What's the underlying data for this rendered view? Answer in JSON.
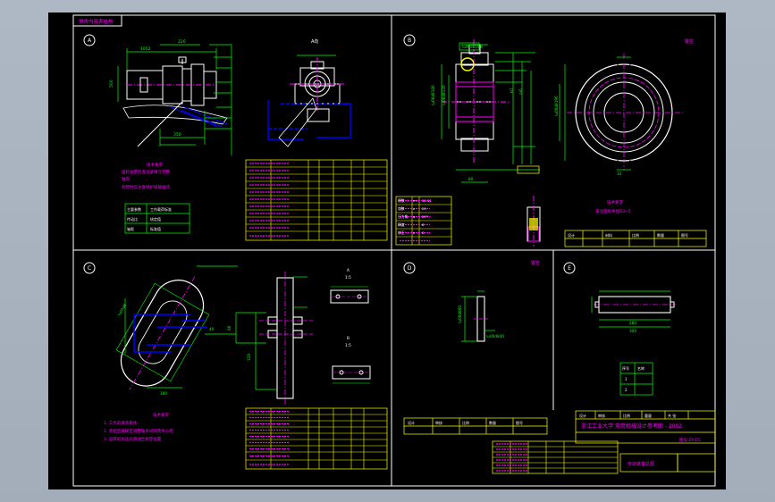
{
  "viewport": {
    "background": "#a9b3c0",
    "canvas_background": "#000000"
  },
  "colors": {
    "frame": "#ffffff",
    "tables": "#ffff00",
    "drawing": "#ffffff",
    "dimensions": "#00ff00",
    "hidden": "#0000ff",
    "centerlines": "#ff00ff",
    "notes": "#ff00ff",
    "highlight": "#ffff00"
  },
  "title_tag": "常青内容表结构",
  "panels": [
    {
      "id": "A",
      "label": "A"
    },
    {
      "id": "B",
      "label": "B"
    },
    {
      "id": "C",
      "label": "C"
    },
    {
      "id": "D",
      "label": "D"
    },
    {
      "id": "E",
      "label": "E"
    }
  ],
  "panel_texts": {
    "a_view": "A向",
    "b_note": "譬空",
    "d_note": "譬空"
  },
  "notes": {
    "a_tech_title": "技术要求",
    "a_tech_lines": [
      "齿轮质量检查记录填写完整",
      "轴向",
      "装配时应注意保护纵轴轴流"
    ],
    "a_small_table": [
      [
        "主要参数",
        "工作载荷标准"
      ],
      [
        "传动比",
        "核定值"
      ],
      [
        "轴距",
        "标准值"
      ]
    ],
    "b_tech_title": "技术要求",
    "b_tech_line": "未注圆角半径R3~5",
    "c_tech_title": "技术要求",
    "c_tech_lines": [
      "1. 工作前清洗箱体",
      "2. 装配后按规定调整轴承间隙及中心距",
      "3. 运转前加注润滑油至规定位置"
    ],
    "e_small_table": [
      [
        "序号",
        "名称"
      ],
      [
        "1",
        ""
      ],
      [
        "2",
        ""
      ]
    ]
  },
  "b_params": [
    [
      "模数",
      "m",
      "11.11"
    ],
    [
      "齿数",
      "z",
      "25"
    ],
    [
      "压力角",
      "α",
      "20°"
    ],
    [
      "精度",
      "",
      "8"
    ],
    [
      "修正",
      "x",
      "0"
    ]
  ],
  "b_title_block": [
    "设计",
    "材料",
    "比例",
    "数量",
    "图号"
  ],
  "d_title_block": [
    "设计",
    "审核",
    "比例",
    "数量",
    "图号"
  ],
  "title_block": {
    "heading": "浙江工业大学 常用机械设计参考图 - 2002",
    "drawing_no": "图号 ZY-15",
    "sheet_name": "传动装置总图",
    "cells": [
      "设计",
      "审核",
      "比例",
      "重量",
      "共 张"
    ]
  }
}
